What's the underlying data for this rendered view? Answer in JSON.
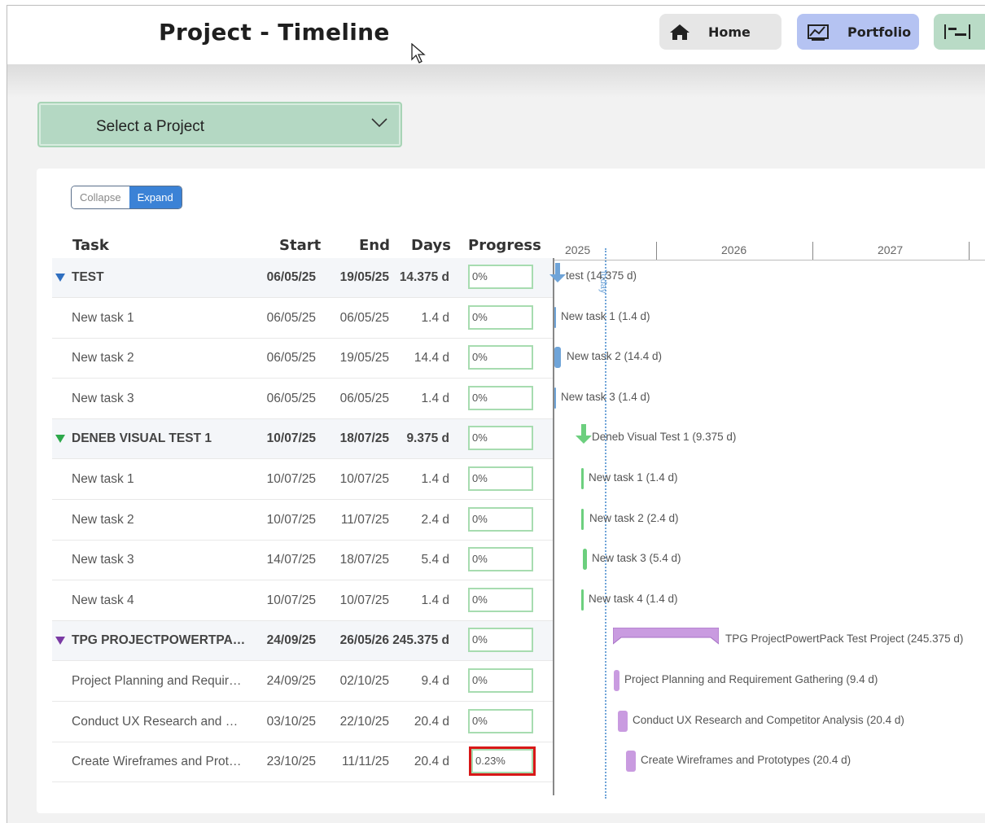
{
  "header": {
    "title": "Project - Timeline",
    "nav": [
      {
        "label": "Home",
        "icon": "home-icon"
      },
      {
        "label": "Portfolio",
        "icon": "chart-icon"
      },
      {
        "label": "",
        "icon": "gantt-icon"
      }
    ]
  },
  "project_select": {
    "label": "Select a Project",
    "icon": "chevron-down-icon"
  },
  "toggle": {
    "collapse": "Collapse",
    "expand": "Expand"
  },
  "table": {
    "columns": [
      "Task",
      "Start",
      "End",
      "Days",
      "Progress"
    ],
    "rows": [
      {
        "task": "TEST",
        "start": "06/05/25",
        "end": "19/05/25",
        "days": "14.375 d",
        "progress": "0%",
        "group": true
      },
      {
        "task": "New task 1",
        "start": "06/05/25",
        "end": "06/05/25",
        "days": "1.4 d",
        "progress": "0%",
        "group": false
      },
      {
        "task": "New task 2",
        "start": "06/05/25",
        "end": "19/05/25",
        "days": "14.4 d",
        "progress": "0%",
        "group": false
      },
      {
        "task": "New task 3",
        "start": "06/05/25",
        "end": "06/05/25",
        "days": "1.4 d",
        "progress": "0%",
        "group": false
      },
      {
        "task": "DENEB VISUAL TEST 1",
        "start": "10/07/25",
        "end": "18/07/25",
        "days": "9.375 d",
        "progress": "0%",
        "group": true
      },
      {
        "task": "New task 1",
        "start": "10/07/25",
        "end": "10/07/25",
        "days": "1.4 d",
        "progress": "0%",
        "group": false
      },
      {
        "task": "New task 2",
        "start": "10/07/25",
        "end": "11/07/25",
        "days": "2.4 d",
        "progress": "0%",
        "group": false
      },
      {
        "task": "New task 3",
        "start": "14/07/25",
        "end": "18/07/25",
        "days": "5.4 d",
        "progress": "0%",
        "group": false
      },
      {
        "task": "New task 4",
        "start": "10/07/25",
        "end": "10/07/25",
        "days": "1.4 d",
        "progress": "0%",
        "group": false
      },
      {
        "task": "TPG PROJECTPOWERTPACK TEST PROJECT",
        "start": "24/09/25",
        "end": "26/05/26",
        "days": "245.375 d",
        "progress": "0%",
        "group": true
      },
      {
        "task": "Project Planning and Requirement Gathering",
        "start": "24/09/25",
        "end": "02/10/25",
        "days": "9.4 d",
        "progress": "0%",
        "group": false
      },
      {
        "task": "Conduct UX Research and Competitor Analysis",
        "start": "03/10/25",
        "end": "22/10/25",
        "days": "20.4 d",
        "progress": "0%",
        "group": false
      },
      {
        "task": "Create Wireframes and Prototypes",
        "start": "23/10/25",
        "end": "11/11/25",
        "days": "20.4 d",
        "progress": "0.23%",
        "group": false,
        "highlighted": true
      }
    ]
  },
  "gantt": {
    "years": [
      "2025",
      "2026",
      "2027"
    ],
    "today_label": "Today",
    "colors": {
      "group1": "#6fa4d8",
      "group2": "#6ccf7e",
      "group3": "#c99be0",
      "highlight": "#d81818"
    },
    "bar_labels": [
      "test (14.375 d)",
      "New task 1 (1.4 d)",
      "New task 2 (14.4 d)",
      "New task 3 (1.4 d)",
      "Deneb Visual Test 1 (9.375 d)",
      "New task 1 (1.4 d)",
      "New task 2 (2.4 d)",
      "New task 3 (5.4 d)",
      "New task 4 (1.4 d)",
      "TPG ProjectPowertPack Test Project (245.375 d)",
      "Project Planning and Requirement Gathering (9.4 d)",
      "Conduct UX Research and Competitor Analysis (20.4 d)",
      "Create Wireframes and Prototypes (20.4 d)"
    ]
  }
}
